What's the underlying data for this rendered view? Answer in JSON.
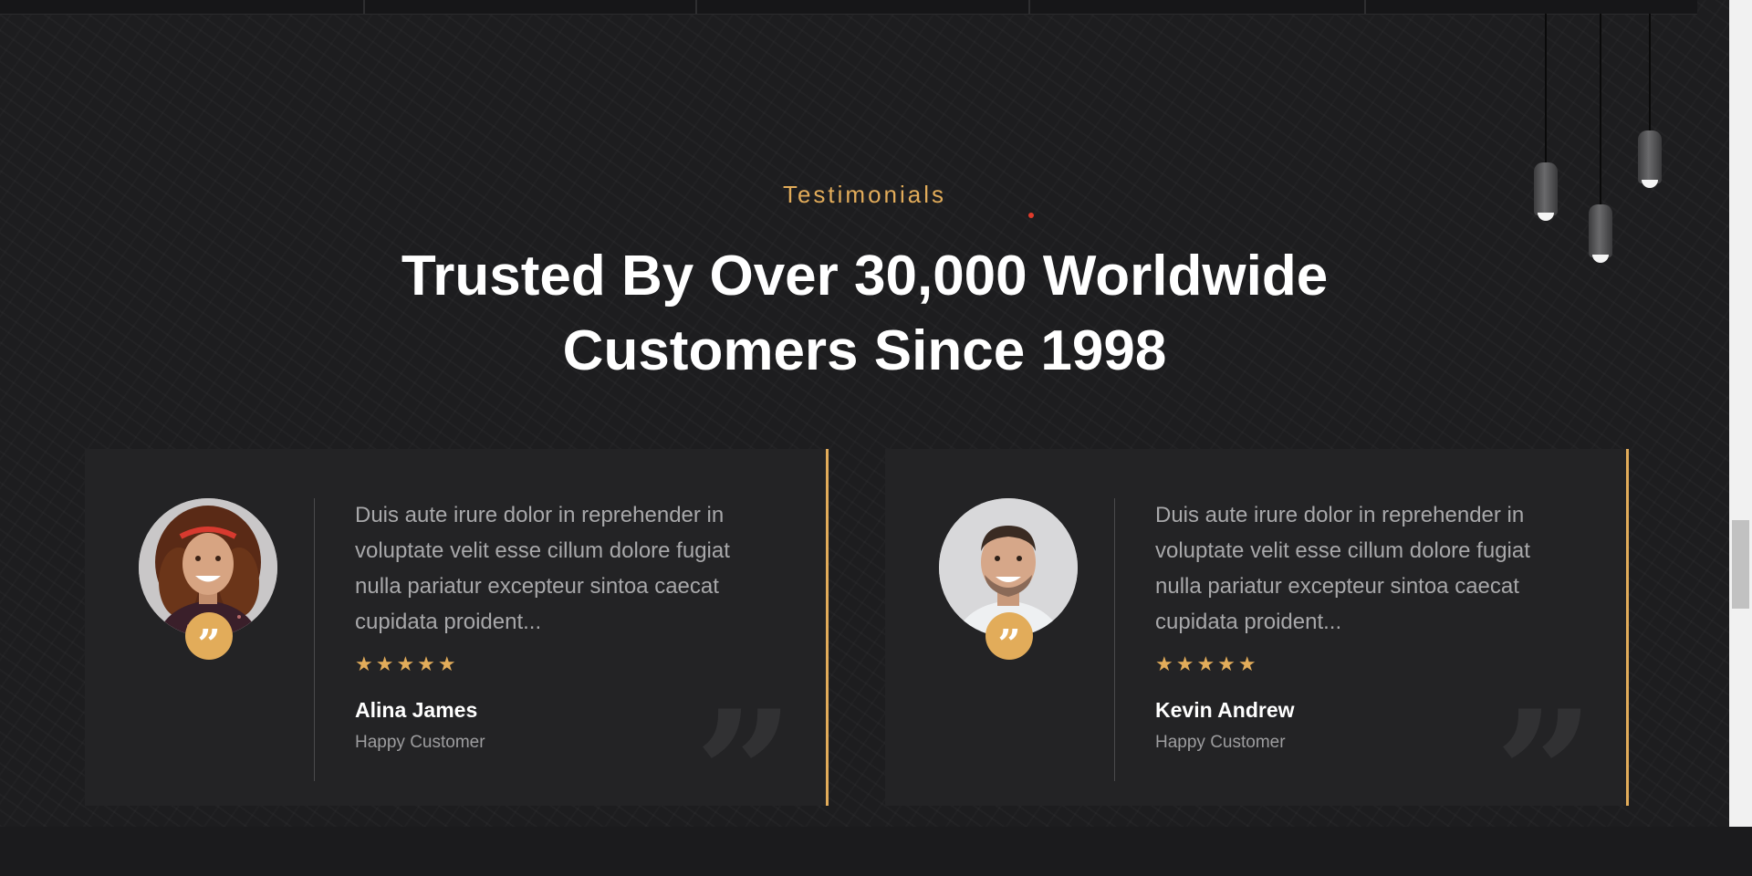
{
  "section": {
    "subtitle": "Testimonials",
    "headline_line1": "Trusted By Over 30,000 Worldwide",
    "headline_line2": "Customers Since 1998"
  },
  "colors": {
    "accent": "#e2ac5a",
    "background": "#1d1d1f",
    "card": "#232325",
    "heading": "#ffffff",
    "body_text": "#a8a8aa"
  },
  "testimonials": [
    {
      "quote": "Duis aute irure dolor in reprehender in voluptate velit esse cillum dolore fugiat nulla pariatur excepteur sintoa caecat cupidata proident...",
      "rating": 5,
      "stars": "★★★★★",
      "name": "Alina James",
      "role": "Happy Customer",
      "avatar": "woman-portrait",
      "quote_icon": "quote-icon"
    },
    {
      "quote": "Duis aute irure dolor in reprehender in voluptate velit esse cillum dolore fugiat nulla pariatur excepteur sintoa caecat cupidata proident...",
      "rating": 5,
      "stars": "★★★★★",
      "name": "Kevin Andrew",
      "role": "Happy Customer",
      "avatar": "man-portrait",
      "quote_icon": "quote-icon"
    }
  ],
  "decor": {
    "quote_badge_glyph": "”",
    "big_quote_glyph": "”",
    "lamps": "pendant-lamp-icon"
  }
}
